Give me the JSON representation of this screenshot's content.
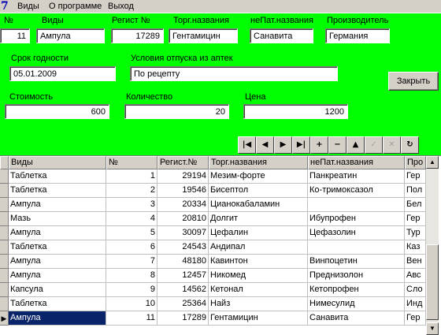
{
  "menu": {
    "items": [
      "Виды",
      "О программе",
      "Выход"
    ]
  },
  "form": {
    "labels": {
      "num": "№",
      "vid": "Виды",
      "regnum": "Регист №",
      "trade": "Торг.названия",
      "nepat": "неПат.названия",
      "maker": "Производитель",
      "expiry": "Срок годности",
      "conditions": "Условия отпуска из аптек",
      "cost": "Стоимость",
      "qty": "Количество",
      "price": "Цена"
    },
    "values": {
      "num": "11",
      "vid": "Ампула",
      "regnum": "17289",
      "trade": "Гентамицин",
      "nepat": "Санавита",
      "maker": "Германия",
      "expiry": "05.01.2009",
      "conditions": "По рецепту",
      "cost": "600",
      "qty": "20",
      "price": "1200"
    },
    "close_label": "Закрыть"
  },
  "navigator": {
    "buttons": [
      "|◀",
      "◀",
      "▶",
      "▶|",
      "+",
      "−",
      "▲",
      "✓",
      "✕",
      "↻"
    ]
  },
  "grid": {
    "columns": [
      "Виды",
      "№",
      "Регист.№",
      "Торг.названия",
      "неПат.названия",
      "Про"
    ],
    "rows": [
      [
        "Таблетка",
        "1",
        "29194",
        "Мезим-форте",
        "Панкреатин",
        "Гер"
      ],
      [
        "Таблетка",
        "2",
        "19546",
        "Бисептол",
        "Ко-тримоксазол",
        "Пол"
      ],
      [
        "Ампула",
        "3",
        "20334",
        "Цианокабаламин",
        "",
        "Бел"
      ],
      [
        "Мазь",
        "4",
        "20810",
        "Долгит",
        "Ибупрофен",
        "Гер"
      ],
      [
        "Ампула",
        "5",
        "30097",
        "Цефалин",
        "Цефазолин",
        "Тур"
      ],
      [
        "Таблетка",
        "6",
        "24543",
        "Андипал",
        "",
        "Каз"
      ],
      [
        "Ампула",
        "7",
        "48180",
        "Кавинтон",
        "Винпоцетин",
        "Вен"
      ],
      [
        "Ампула",
        "8",
        "12457",
        "Никомед",
        "Преднизолон",
        "Авс"
      ],
      [
        "Капсула",
        "9",
        "14562",
        "Кетонал",
        "Кетопрофен",
        "Сло"
      ],
      [
        "Таблетка",
        "10",
        "25364",
        "Найз",
        "Нимесулид",
        "Инд"
      ],
      [
        "Ампула",
        "11",
        "17289",
        "Гентамицин",
        "Санавита",
        "Гер"
      ]
    ],
    "selected_row": 10
  }
}
